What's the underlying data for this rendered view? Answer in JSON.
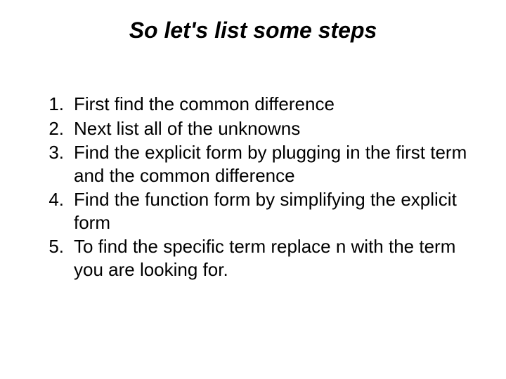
{
  "title": "So let's list some steps",
  "items": [
    {
      "number": "1.",
      "text": "First find the common difference"
    },
    {
      "number": "2.",
      "text": "Next list all of the unknowns"
    },
    {
      "number": "3.",
      "text": "Find the explicit form by plugging in the first term and the common difference"
    },
    {
      "number": "4.",
      "text": "Find the function form by simplifying the explicit form"
    },
    {
      "number": "5.",
      "text": "To find the specific term replace n with the term you are looking for."
    }
  ]
}
